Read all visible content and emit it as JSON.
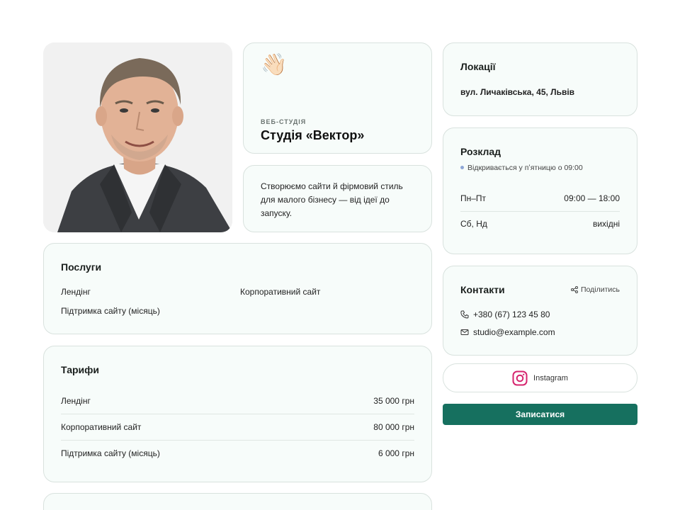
{
  "profile": {
    "photo_alt": "Portrait"
  },
  "studio": {
    "emoji": "👋🏻",
    "eyebrow": "ВЕБ-СТУДІЯ",
    "name": "Студія «Вектор»",
    "description": "Створюємо сайти й фірмовий стиль для малого бізнесу — від ідеї до запуску."
  },
  "services": {
    "title": "Послуги",
    "items": [
      "Лендінг",
      "Корпоративний сайт",
      "Підтримка сайту (місяць)"
    ]
  },
  "pricing": {
    "title": "Тарифи",
    "rows": [
      {
        "name": "Лендінг",
        "price": "35 000 грн"
      },
      {
        "name": "Корпоративний сайт",
        "price": "80 000 грн"
      },
      {
        "name": "Підтримка сайту (місяць)",
        "price": "6 000 грн"
      }
    ]
  },
  "locations": {
    "title": "Локації",
    "address": "вул. Личаківська, 45, Львів"
  },
  "schedule": {
    "title": "Розклад",
    "status": "Відкривається у пʼятницю о 09:00",
    "status_color": "#8ea6d6",
    "rows": [
      {
        "days": "Пн–Пт",
        "hours": "09:00 — 18:00"
      },
      {
        "days": "Сб, Нд",
        "hours": "вихідні"
      }
    ]
  },
  "contacts": {
    "title": "Контакти",
    "share_label": "Поділитись",
    "phone": "+380 (67) 123 45 80",
    "email": "studio@example.com",
    "icons": {
      "share": "share-icon",
      "phone": "phone-icon",
      "email": "mail-icon"
    }
  },
  "social": {
    "instagram_label": "Instagram",
    "instagram_icon": "instagram-icon"
  },
  "cta": {
    "book_label": "Записатися",
    "color": "#16705f"
  }
}
